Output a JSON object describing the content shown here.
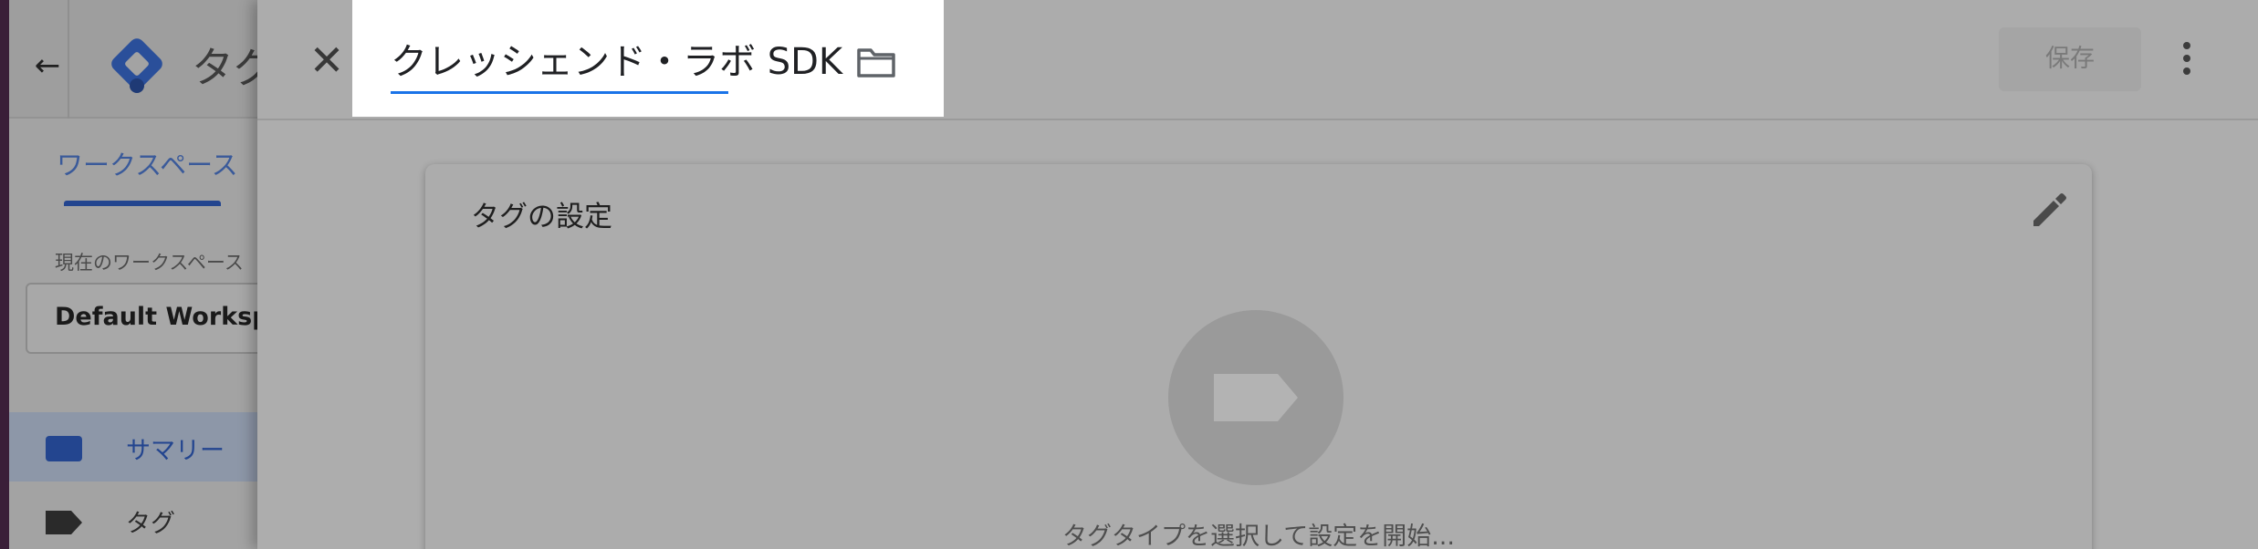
{
  "background_app": {
    "back_icon": "arrow-back-icon",
    "logo_icon": "gtm-logo-icon",
    "title": "タグ",
    "tab_label": "ワークスペース",
    "workspace_label": "現在のワークスペース",
    "workspace_value": "Default Workspa",
    "nav": [
      {
        "label": "サマリー",
        "icon": "briefcase-icon",
        "active": true
      },
      {
        "label": "タグ",
        "icon": "tag-icon",
        "active": false
      }
    ]
  },
  "drawer": {
    "close_icon": "close-icon",
    "tag_name": "クレッシェンド・ラボ SDK",
    "folder_icon": "folder-icon",
    "save_label": "保存",
    "more_icon": "more-vert-icon",
    "card": {
      "title": "タグの設定",
      "edit_icon": "pencil-icon",
      "type_icon": "tag-icon",
      "hint": "タグタイプを選択して設定を開始..."
    }
  },
  "colors": {
    "accent_blue": "#1a73e8",
    "nav_active_blue": "#23458f",
    "overlay_gray": "#adadad"
  }
}
